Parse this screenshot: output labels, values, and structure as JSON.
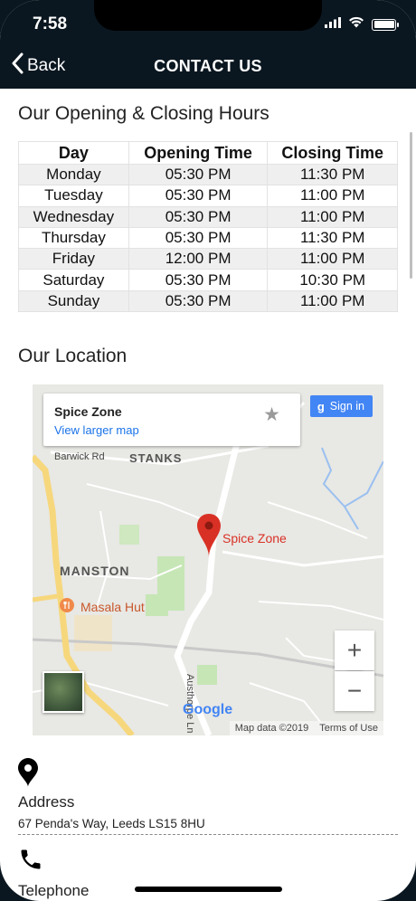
{
  "status_bar": {
    "time": "7:58"
  },
  "nav": {
    "back_label": "Back",
    "title": "CONTACT US"
  },
  "hours": {
    "title": "Our Opening & Closing Hours",
    "headers": [
      "Day",
      "Opening Time",
      "Closing Time"
    ],
    "rows": [
      [
        "Monday",
        "05:30 PM",
        "11:30 PM"
      ],
      [
        "Tuesday",
        "05:30 PM",
        "11:00 PM"
      ],
      [
        "Wednesday",
        "05:30 PM",
        "11:00 PM"
      ],
      [
        "Thursday",
        "05:30 PM",
        "11:30 PM"
      ],
      [
        "Friday",
        "12:00 PM",
        "11:00 PM"
      ],
      [
        "Saturday",
        "05:30 PM",
        "10:30 PM"
      ],
      [
        "Sunday",
        "05:30 PM",
        "11:00 PM"
      ]
    ]
  },
  "location": {
    "title": "Our Location",
    "map": {
      "card_name": "Spice Zone",
      "card_link": "View larger map",
      "sign_in": "Sign in",
      "sign_in_g": "g",
      "pin_label": "Spice Zone",
      "poi_label": "Masala Hut",
      "area_stanks": "STANKS",
      "area_manston": "MANSTON",
      "road_barwick": "Barwick Rd",
      "road_austhorpe": "Austhorpe Ln",
      "zoom_in": "+",
      "zoom_out": "−",
      "google": "Google",
      "map_data": "Map data ©2019",
      "terms": "Terms of Use",
      "pin_color": "#d93025",
      "link_color": "#1a73e8"
    }
  },
  "contact": {
    "address_label": "Address",
    "address_value": "67 Penda's Way, Leeds LS15 8HU",
    "telephone_label": "Telephone"
  },
  "icons": {
    "back": "chevron-left-icon",
    "wifi": "wifi-icon",
    "battery": "battery-icon",
    "star": "star-icon",
    "pin": "map-pin-icon",
    "phone": "phone-icon"
  },
  "colors": {
    "header_bg": "#0b1720",
    "table_stripe": "#efefef"
  }
}
